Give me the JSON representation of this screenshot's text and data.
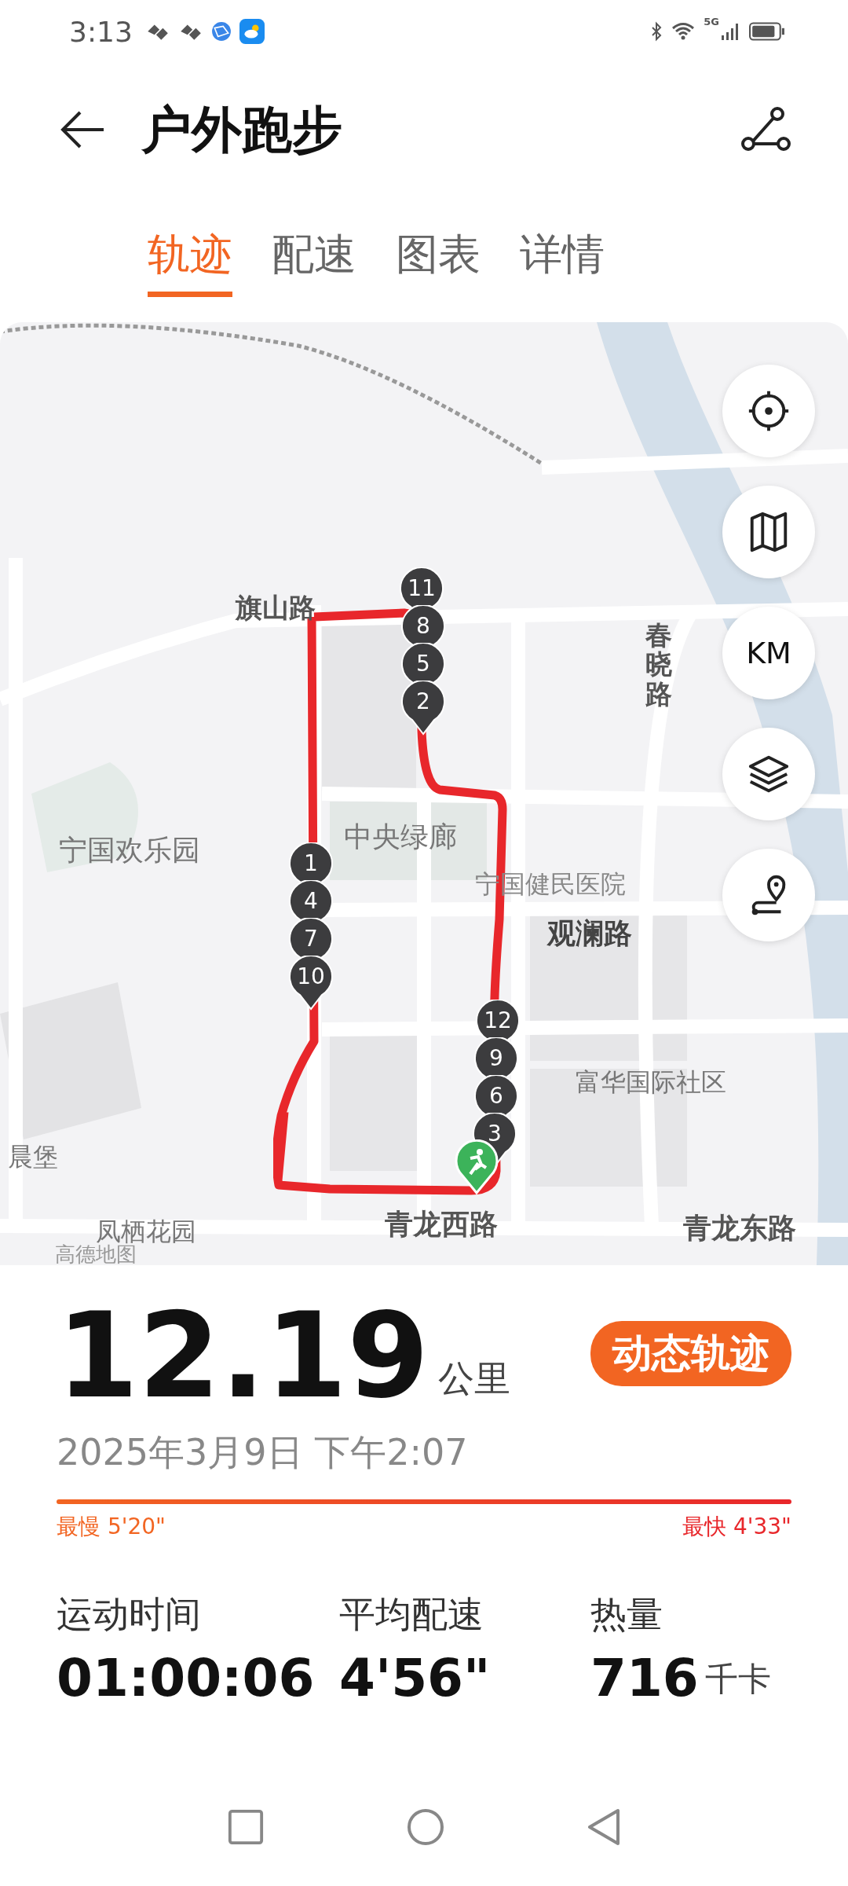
{
  "status_bar": {
    "time": "3:13",
    "network": "5G"
  },
  "header": {
    "title": "户外跑步"
  },
  "tabs": [
    {
      "label": "轨迹",
      "selected": true
    },
    {
      "label": "配速",
      "selected": false
    },
    {
      "label": "图表",
      "selected": false
    },
    {
      "label": "详情",
      "selected": false
    }
  ],
  "map": {
    "labels": [
      {
        "text": "旗山路",
        "kind": "road"
      },
      {
        "text": "春晓路",
        "kind": "vertical"
      },
      {
        "text": "宁国欢乐园",
        "kind": "place"
      },
      {
        "text": "中央绿廊",
        "kind": "place"
      },
      {
        "text": "宁国健民医院",
        "kind": "poi"
      },
      {
        "text": "观澜路",
        "kind": "major"
      },
      {
        "text": "富华国际社区",
        "kind": "place"
      },
      {
        "text": "晨堡",
        "kind": "place"
      },
      {
        "text": "凤栖花园",
        "kind": "place"
      },
      {
        "text": "青龙西路",
        "kind": "road"
      },
      {
        "text": "青龙东路",
        "kind": "road"
      },
      {
        "text": "高德地图",
        "kind": "attribution"
      }
    ],
    "km_markers": [
      "11",
      "8",
      "5",
      "2",
      "1",
      "4",
      "7",
      "10",
      "12",
      "9",
      "6",
      "3"
    ],
    "controls": [
      {
        "kind": "locate"
      },
      {
        "kind": "map"
      },
      {
        "kind": "km",
        "label": "KM"
      },
      {
        "kind": "layers"
      },
      {
        "kind": "route"
      }
    ]
  },
  "summary": {
    "distance": "12.19",
    "unit": "公里",
    "button": "动态轨迹",
    "date": "2025年3月9日 下午2:07",
    "slowest": "最慢 5'20\"",
    "fastest": "最快 4'33\""
  },
  "stats": [
    {
      "label": "运动时间",
      "value": "01:00:06"
    },
    {
      "label": "平均配速",
      "value": "4'56\""
    },
    {
      "label": "热量",
      "value": "716",
      "unit": "千卡"
    }
  ]
}
